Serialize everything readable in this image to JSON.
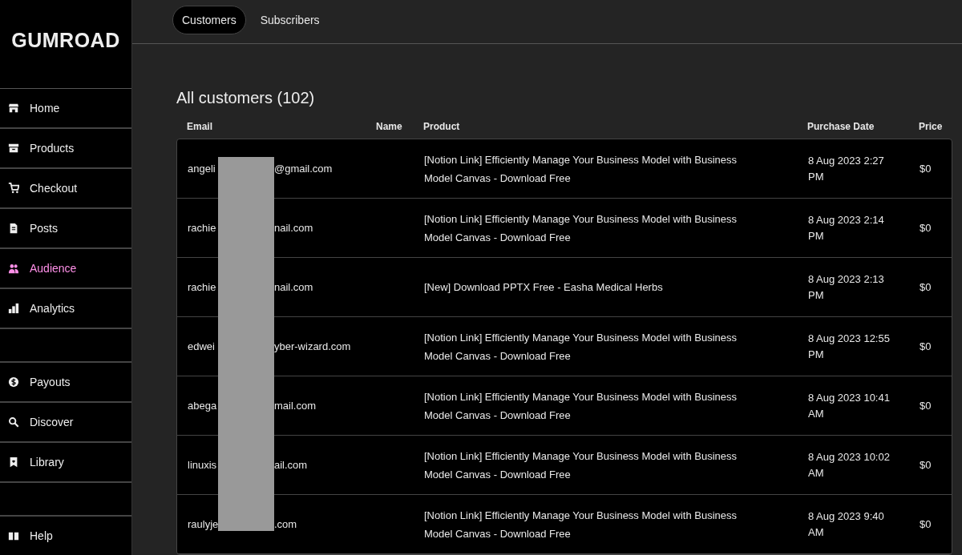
{
  "sidebar": {
    "logo": "GUMROAD",
    "groups": [
      [
        {
          "label": "Home",
          "kind": "store",
          "selected": false
        },
        {
          "label": "Products",
          "kind": "archive",
          "selected": false
        },
        {
          "label": "Checkout",
          "kind": "cart",
          "selected": false
        },
        {
          "label": "Posts",
          "kind": "document",
          "selected": false
        },
        {
          "label": "Audience",
          "kind": "people",
          "selected": true
        },
        {
          "label": "Analytics",
          "kind": "bars",
          "selected": false
        }
      ],
      [
        {
          "label": "Payouts",
          "kind": "dollar",
          "selected": false
        },
        {
          "label": "Discover",
          "kind": "search",
          "selected": false
        },
        {
          "label": "Library",
          "kind": "bookmark",
          "selected": false
        }
      ],
      [
        {
          "label": "Help",
          "kind": "book",
          "selected": false
        }
      ]
    ]
  },
  "tabs": [
    {
      "label": "Customers",
      "selected": true
    },
    {
      "label": "Subscribers",
      "selected": false
    }
  ],
  "heading": "All customers (102)",
  "table": {
    "columns": [
      "Email",
      "Name",
      "Product",
      "Purchase Date",
      "Price"
    ],
    "rows": [
      {
        "email_start": "angeli",
        "email_end": "@gmail.com",
        "product": "[Notion Link] Efficiently Manage Your Business Model with Business Model Canvas - Download Free",
        "date": "8 Aug 2023 2:27 PM",
        "price": "$0"
      },
      {
        "email_start": "rachie",
        "email_end": "nail.com",
        "product": "[Notion Link] Efficiently Manage Your Business Model with Business Model Canvas - Download Free",
        "date": "8 Aug 2023 2:14 PM",
        "price": "$0"
      },
      {
        "email_start": "rachie",
        "email_end": "nail.com",
        "product": "[New] Download PPTX Free - Easha Medical Herbs",
        "date": "8 Aug 2023 2:13 PM",
        "price": "$0"
      },
      {
        "email_start": "edwei",
        "email_end": "yber-wizard.com",
        "product": "[Notion Link] Efficiently Manage Your Business Model with Business Model Canvas - Download Free",
        "date": "8 Aug 2023 12:55 PM",
        "price": "$0"
      },
      {
        "email_start": "abega",
        "email_end": "mail.com",
        "product": "[Notion Link] Efficiently Manage Your Business Model with Business Model Canvas - Download Free",
        "date": "8 Aug 2023 10:41 AM",
        "price": "$0"
      },
      {
        "email_start": "linuxis",
        "email_end": "ail.com",
        "product": "[Notion Link] Efficiently Manage Your Business Model with Business Model Canvas - Download Free",
        "date": "8 Aug 2023 10:02 AM",
        "price": "$0"
      },
      {
        "email_start": "raulyje",
        "email_end": ".com",
        "product": "[Notion Link] Efficiently Manage Your Business Model with Business Model Canvas - Download Free",
        "date": "8 Aug 2023 9:40 AM",
        "price": "$0"
      }
    ]
  }
}
